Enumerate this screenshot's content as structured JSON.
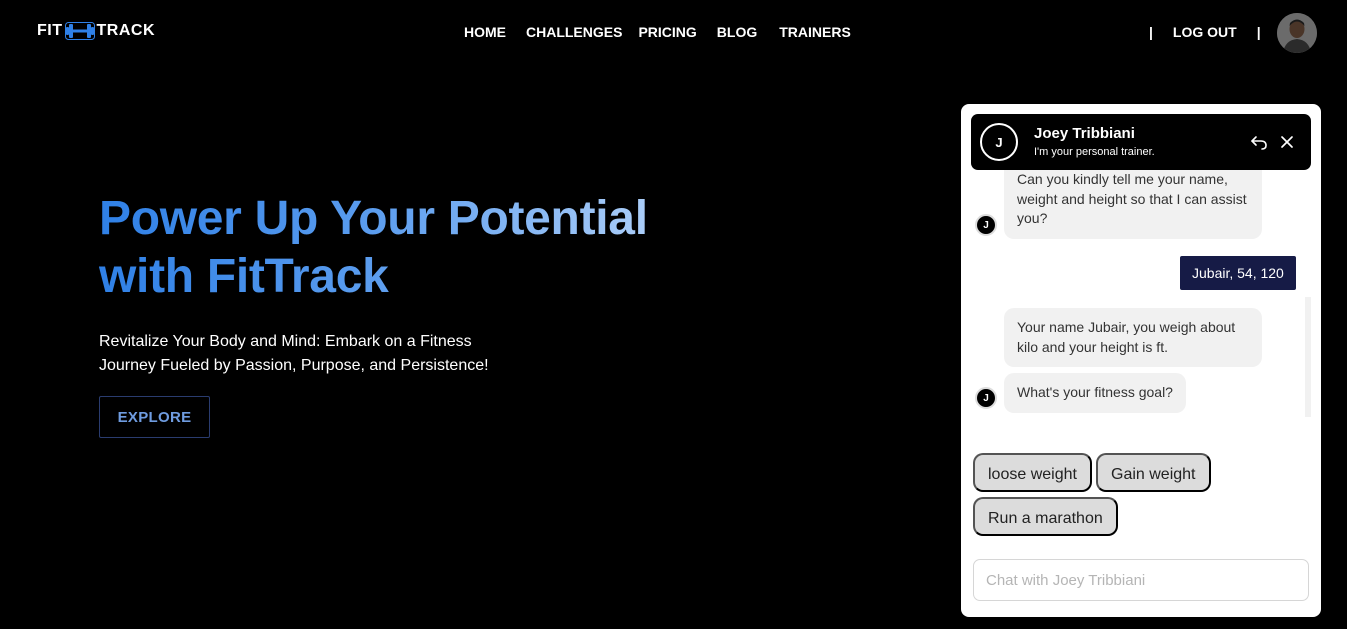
{
  "brand": {
    "left": "FIT",
    "right": "TRACK"
  },
  "nav": {
    "items": [
      "HOME",
      "CHALLENGES",
      "PRICING",
      "BLOG",
      "TRAINERS"
    ],
    "separator": "|",
    "logout": "LOG OUT"
  },
  "hero": {
    "title_line1": "Power Up Your Potential",
    "title_line2": "with FitTrack",
    "subtitle": "Revitalize Your Body and Mind: Embark on a Fitness Journey Fueled by Passion, Purpose, and Persistence!",
    "cta": "EXPLORE"
  },
  "chat": {
    "trainer_initial": "J",
    "trainer_name": "Joey Tribbiani",
    "trainer_tagline": "I'm your personal trainer.",
    "messages": [
      {
        "from": "bot",
        "text": "Can you kindly tell me your name, weight and height so that I can assist you?"
      },
      {
        "from": "user",
        "text": "Jubair, 54, 120"
      },
      {
        "from": "bot",
        "text": "Your name Jubair, you weigh about kilo and your height is  ft."
      },
      {
        "from": "bot",
        "text": "What's your fitness goal?"
      }
    ],
    "options": [
      "loose weight",
      "Gain weight",
      "Run a marathon"
    ],
    "input_placeholder": "Chat with Joey Tribbiani"
  },
  "colors": {
    "accent_blue": "#2f80e6",
    "user_bubble": "#161b46",
    "background": "#000000"
  },
  "icons": [
    "dumbbell-icon",
    "back-arrow-icon",
    "close-icon"
  ]
}
